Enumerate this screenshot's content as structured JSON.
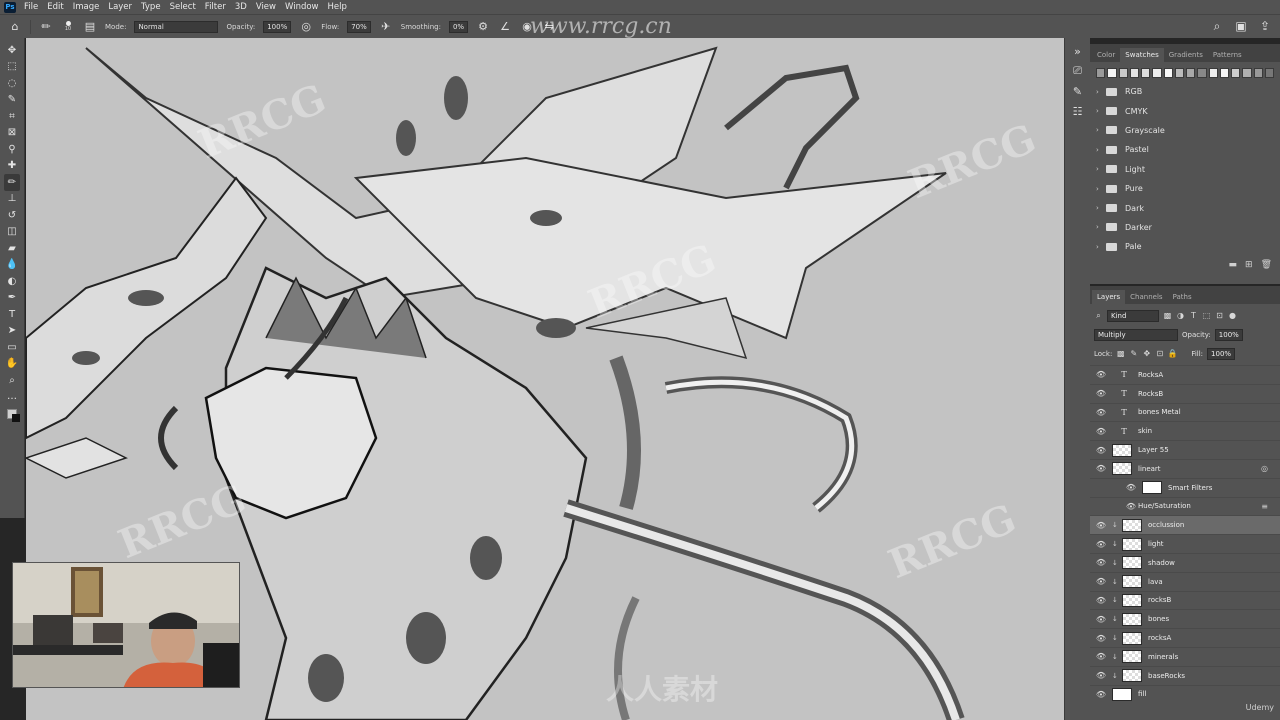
{
  "app": {
    "logo": "Ps",
    "menu": [
      "File",
      "Edit",
      "Image",
      "Layer",
      "Type",
      "Select",
      "Filter",
      "3D",
      "View",
      "Window",
      "Help"
    ]
  },
  "options": {
    "brush_size": "10",
    "mode_label": "Mode:",
    "mode_value": "Normal",
    "opacity_label": "Opacity:",
    "opacity_value": "100%",
    "flow_label": "Flow:",
    "flow_value": "70%",
    "smoothing_label": "Smoothing:",
    "smoothing_value": "0%"
  },
  "tools": [
    {
      "name": "move-tool-icon",
      "glyph": "✥"
    },
    {
      "name": "marquee-tool-icon",
      "glyph": "⬚"
    },
    {
      "name": "lasso-tool-icon",
      "glyph": "◌"
    },
    {
      "name": "quick-select-tool-icon",
      "glyph": "✎"
    },
    {
      "name": "crop-tool-icon",
      "glyph": "⌗"
    },
    {
      "name": "frame-tool-icon",
      "glyph": "⊠"
    },
    {
      "name": "eyedropper-tool-icon",
      "glyph": "⚲"
    },
    {
      "name": "healing-tool-icon",
      "glyph": "✚"
    },
    {
      "name": "brush-tool-icon",
      "glyph": "✏"
    },
    {
      "name": "stamp-tool-icon",
      "glyph": "⊥"
    },
    {
      "name": "history-brush-icon",
      "glyph": "↺"
    },
    {
      "name": "eraser-tool-icon",
      "glyph": "◫"
    },
    {
      "name": "gradient-tool-icon",
      "glyph": "▰"
    },
    {
      "name": "blur-tool-icon",
      "glyph": "💧"
    },
    {
      "name": "dodge-tool-icon",
      "glyph": "◐"
    },
    {
      "name": "pen-tool-icon",
      "glyph": "✒"
    },
    {
      "name": "type-tool-icon",
      "glyph": "T"
    },
    {
      "name": "path-select-tool-icon",
      "glyph": "➤"
    },
    {
      "name": "shape-tool-icon",
      "glyph": "▭"
    },
    {
      "name": "hand-tool-icon",
      "glyph": "✋"
    },
    {
      "name": "zoom-tool-icon",
      "glyph": "⌕"
    },
    {
      "name": "more-tools-icon",
      "glyph": "…"
    }
  ],
  "swatches_panel": {
    "tabs": [
      "Color",
      "Swatches",
      "Gradients",
      "Patterns"
    ],
    "active_tab": "Swatches",
    "recent_colors": [
      "#9a9a9a",
      "#f4f4f4",
      "#c8c8c8",
      "#e2e2e2",
      "#dddddd",
      "#eeeeee",
      "#f8f8f8",
      "#bbbbbb",
      "#a8a8a8",
      "#888888",
      "#eeeeee",
      "#f4f4f4",
      "#cccccc",
      "#b0b0b0",
      "#999999",
      "#777777"
    ],
    "groups": [
      "RGB",
      "CMYK",
      "Grayscale",
      "Pastel",
      "Light",
      "Pure",
      "Dark",
      "Darker",
      "Pale"
    ]
  },
  "layers_panel": {
    "tabs": [
      "Layers",
      "Channels",
      "Paths"
    ],
    "active_tab": "Layers",
    "filter_value": "Kind",
    "blend_mode": "Multiply",
    "opacity_label": "Opacity:",
    "opacity_value": "100%",
    "lock_label": "Lock:",
    "fill_label": "Fill:",
    "fill_value": "100%",
    "layers": [
      {
        "name": "RocksA",
        "kind": "text"
      },
      {
        "name": "RocksB",
        "kind": "text"
      },
      {
        "name": "bones Metal",
        "kind": "text"
      },
      {
        "name": "skin",
        "kind": "text"
      },
      {
        "name": "Layer 55",
        "kind": "raster"
      },
      {
        "name": "lineart",
        "kind": "smart"
      },
      {
        "name": "Smart Filters",
        "kind": "filter-head"
      },
      {
        "name": "Hue/Saturation",
        "kind": "filter"
      },
      {
        "name": "occlussion",
        "kind": "clip",
        "selected": true
      },
      {
        "name": "light",
        "kind": "clip"
      },
      {
        "name": "shadow",
        "kind": "clip"
      },
      {
        "name": "lava",
        "kind": "clip"
      },
      {
        "name": "rocksB",
        "kind": "clip"
      },
      {
        "name": "bones",
        "kind": "clip"
      },
      {
        "name": "rocksA",
        "kind": "clip"
      },
      {
        "name": "minerals",
        "kind": "clip"
      },
      {
        "name": "baseRocks",
        "kind": "clip"
      },
      {
        "name": "fill",
        "kind": "solid"
      }
    ]
  },
  "overlays": {
    "site_watermark": "www.rrcg.cn",
    "watermark_text": "RRCG",
    "watermark_cn": "人人素材",
    "udemy": "Udemy"
  }
}
